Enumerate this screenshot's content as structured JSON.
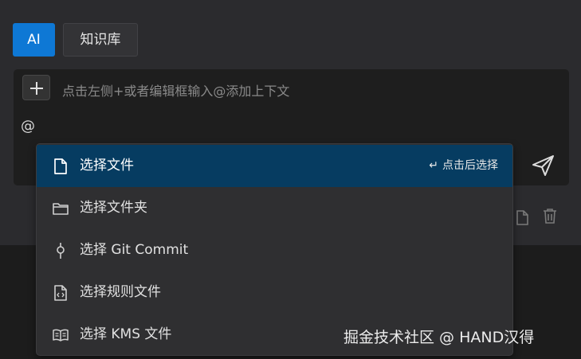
{
  "tabs": [
    {
      "label": "AI",
      "active": true
    },
    {
      "label": "知识库",
      "active": false
    }
  ],
  "input": {
    "placeholder": "点击左侧+或者编辑框输入@添加上下文",
    "value": "@"
  },
  "context_menu": {
    "hint": "点击后选择",
    "items": [
      {
        "label": "选择文件",
        "icon": "file-icon",
        "selected": true
      },
      {
        "label": "选择文件夹",
        "icon": "folder-icon",
        "selected": false
      },
      {
        "label": "选择 Git Commit",
        "icon": "git-commit-icon",
        "selected": false
      },
      {
        "label": "选择规则文件",
        "icon": "code-file-icon",
        "selected": false
      },
      {
        "label": "选择 KMS 文件",
        "icon": "book-icon",
        "selected": false
      }
    ]
  },
  "watermark": "掘金技术社区 @ HAND汉得",
  "colors": {
    "accent": "#0e78d5",
    "selected_item": "#063c61",
    "panel": "#2b2b2e",
    "input_bg": "#1e1e1e"
  }
}
